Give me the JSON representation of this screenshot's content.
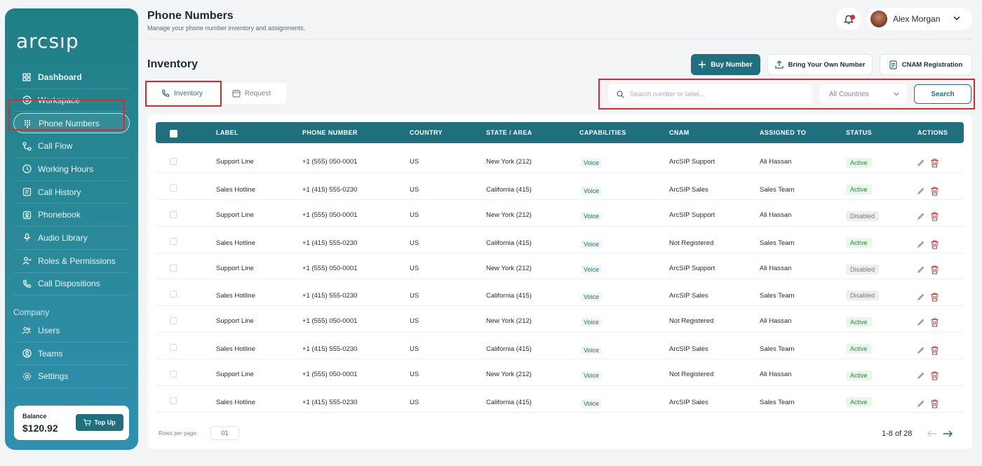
{
  "brand": {
    "logo_text": "arcsıp"
  },
  "sidebar": {
    "items": [
      {
        "label": "Dashboard",
        "icon": "grid-icon"
      },
      {
        "label": "Workspace",
        "icon": "workspace-icon"
      },
      {
        "label": "Phone Numbers",
        "icon": "keypad-icon"
      },
      {
        "label": "Call Flow",
        "icon": "flow-icon"
      },
      {
        "label": "Working Hours",
        "icon": "clock-icon"
      },
      {
        "label": "Call History",
        "icon": "history-icon"
      },
      {
        "label": "Phonebook",
        "icon": "phonebook-icon"
      },
      {
        "label": "Audio Library",
        "icon": "audio-icon"
      },
      {
        "label": "Roles & Permissions",
        "icon": "user-check-icon"
      },
      {
        "label": "Call Dispositions",
        "icon": "phone-icon"
      }
    ],
    "company_title": "Company",
    "company_items": [
      {
        "label": "Users",
        "icon": "users-icon"
      },
      {
        "label": "Teams",
        "icon": "team-icon"
      },
      {
        "label": "Settings",
        "icon": "gear-icon"
      }
    ],
    "balance": {
      "label": "Balance",
      "value": "$120.92",
      "topup_label": "Top Up"
    }
  },
  "header": {
    "title": "Phone Numbers",
    "subtitle": "Manage your phone number inventory and assignments.",
    "user_name": "Alex Morgan"
  },
  "inventory": {
    "title": "Inventory",
    "buttons": {
      "buy": "Buy Number",
      "byon": "Bring Your Own Number",
      "cnam": "CNAM Registration"
    },
    "tabs": [
      {
        "label": "Inventory"
      },
      {
        "label": "Request"
      }
    ],
    "search": {
      "placeholder": "Search number or label...",
      "value": ""
    },
    "country_select": "All Countries",
    "search_button": "Search"
  },
  "table": {
    "columns": [
      "LABEL",
      "PHONE NUMBER",
      "COUNTRY",
      "STATE / AREA",
      "CAPABILITIES",
      "CNAM",
      "ASSIGNED TO",
      "STATUS",
      "ACTIONS"
    ],
    "rows": [
      {
        "label": "Support Line",
        "phone": "+1 (555) 050-0001",
        "country": "US",
        "state": "New York (212)",
        "cap": "Voice",
        "cnam": "ArcSIP Support",
        "assigned": "Ali Hassan",
        "status": "Active"
      },
      {
        "label": "Sales Hotline",
        "phone": "+1 (415) 555-0230",
        "country": "US",
        "state": "California (415)",
        "cap": "Voice",
        "cnam": "ArcSIP Sales",
        "assigned": "Sales Team",
        "status": "Active"
      },
      {
        "label": "Support Line",
        "phone": "+1 (555) 050-0001",
        "country": "US",
        "state": "New York (212)",
        "cap": "Voice",
        "cnam": "ArcSIP Support",
        "assigned": "Ali Hassan",
        "status": "Disabled"
      },
      {
        "label": "Sales Hotline",
        "phone": "+1 (415) 555-0230",
        "country": "US",
        "state": "California (415)",
        "cap": "Voice",
        "cnam": "Not Registered",
        "assigned": "Sales Team",
        "status": "Active"
      },
      {
        "label": "Support Line",
        "phone": "+1 (555) 050-0001",
        "country": "US",
        "state": "New York (212)",
        "cap": "Voice",
        "cnam": "ArcSIP Support",
        "assigned": "Ali Hassan",
        "status": "Disabled"
      },
      {
        "label": "Sales Hotline",
        "phone": "+1 (415) 555-0230",
        "country": "US",
        "state": "California (415)",
        "cap": "Voice",
        "cnam": "ArcSIP Sales",
        "assigned": "Sales Team",
        "status": "Disabled"
      },
      {
        "label": "Support Line",
        "phone": "+1 (555) 050-0001",
        "country": "US",
        "state": "New York (212)",
        "cap": "Voice",
        "cnam": "Not Registered",
        "assigned": "Ali Hassan",
        "status": "Active"
      },
      {
        "label": "Sales Hotline",
        "phone": "+1 (415) 555-0230",
        "country": "US",
        "state": "California (415)",
        "cap": "Voice",
        "cnam": "ArcSIP Sales",
        "assigned": "Sales Team",
        "status": "Active"
      },
      {
        "label": "Support Line",
        "phone": "+1 (555) 050-0001",
        "country": "US",
        "state": "New York (212)",
        "cap": "Voice",
        "cnam": "Not Registered",
        "assigned": "Ali Hassan",
        "status": "Active"
      },
      {
        "label": "Sales Hotline",
        "phone": "+1 (415) 555-0230",
        "country": "US",
        "state": "California (415)",
        "cap": "Voice",
        "cnam": "ArcSIP Sales",
        "assigned": "Sales Team",
        "status": "Active"
      }
    ]
  },
  "pagination": {
    "rows_label": "Rows per page:",
    "rows_value": "01",
    "range": "1-8 of 28"
  },
  "colors": {
    "primary": "#1f6f7f",
    "active_bg": "#e7f7ea",
    "danger": "#e02a2a"
  }
}
